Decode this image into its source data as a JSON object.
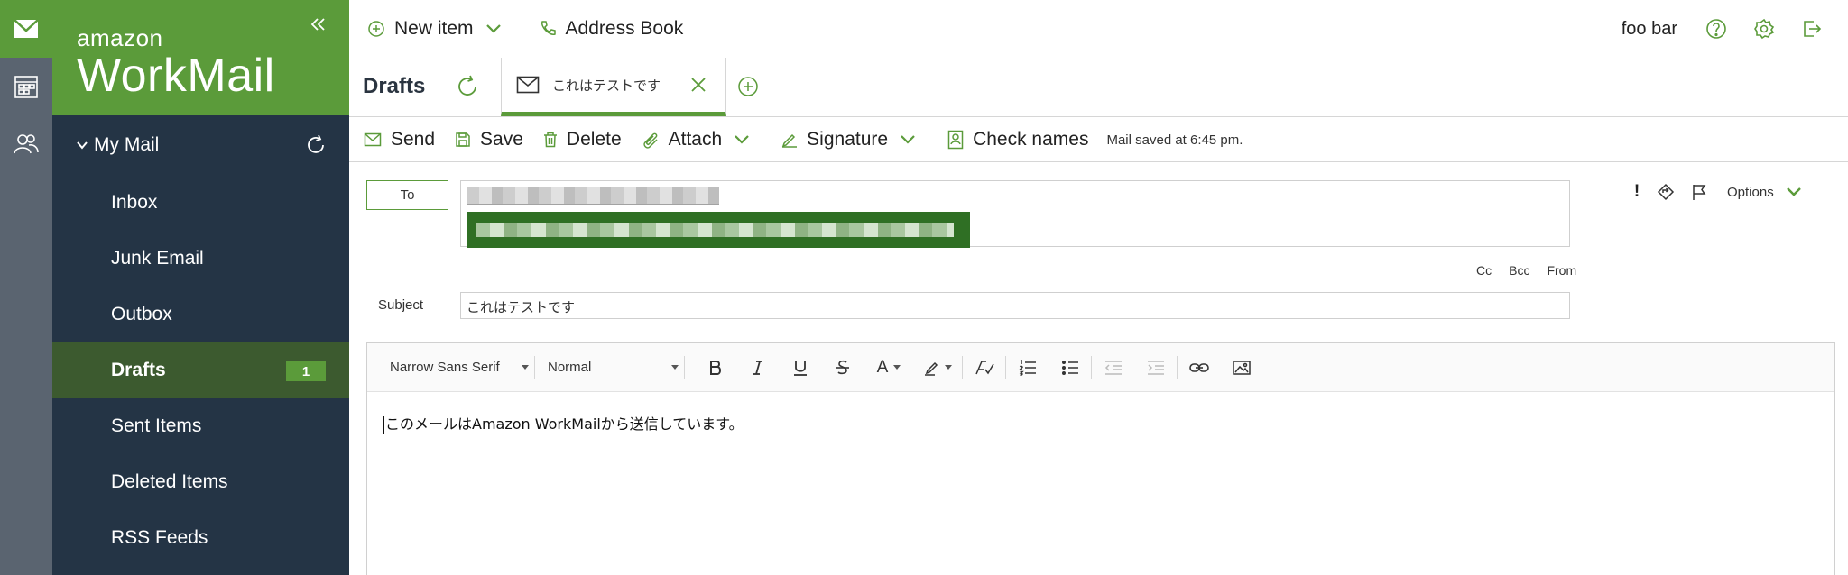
{
  "brand": {
    "line1": "amazon",
    "line2": "WorkMail"
  },
  "folders": {
    "group_label": "My Mail",
    "items": [
      {
        "label": "Inbox"
      },
      {
        "label": "Junk Email"
      },
      {
        "label": "Outbox"
      },
      {
        "label": "Drafts",
        "count": "1"
      },
      {
        "label": "Sent Items"
      },
      {
        "label": "Deleted Items"
      },
      {
        "label": "RSS Feeds"
      }
    ]
  },
  "topbar": {
    "new_item": "New item",
    "address_book": "Address Book",
    "user": "foo bar"
  },
  "title": {
    "folder": "Drafts",
    "tab_label": "これはテストです"
  },
  "toolbar": {
    "send": "Send",
    "save": "Save",
    "delete": "Delete",
    "attach": "Attach",
    "signature": "Signature",
    "check_names": "Check names",
    "status": "Mail saved at 6:45 pm."
  },
  "compose": {
    "to_label": "To",
    "importance": "!",
    "options": "Options",
    "cc": "Cc",
    "bcc": "Bcc",
    "from": "From",
    "subject_label": "Subject",
    "subject_value": "これはテストです"
  },
  "editor": {
    "font": "Narrow Sans Serif",
    "size": "Normal",
    "font_color_glyph": "A",
    "body": "このメールはAmazon WorkMailから送信しています。"
  },
  "colors": {
    "accent": "#5b9b3a",
    "sidebar": "#243445",
    "rail": "#5a6470"
  }
}
